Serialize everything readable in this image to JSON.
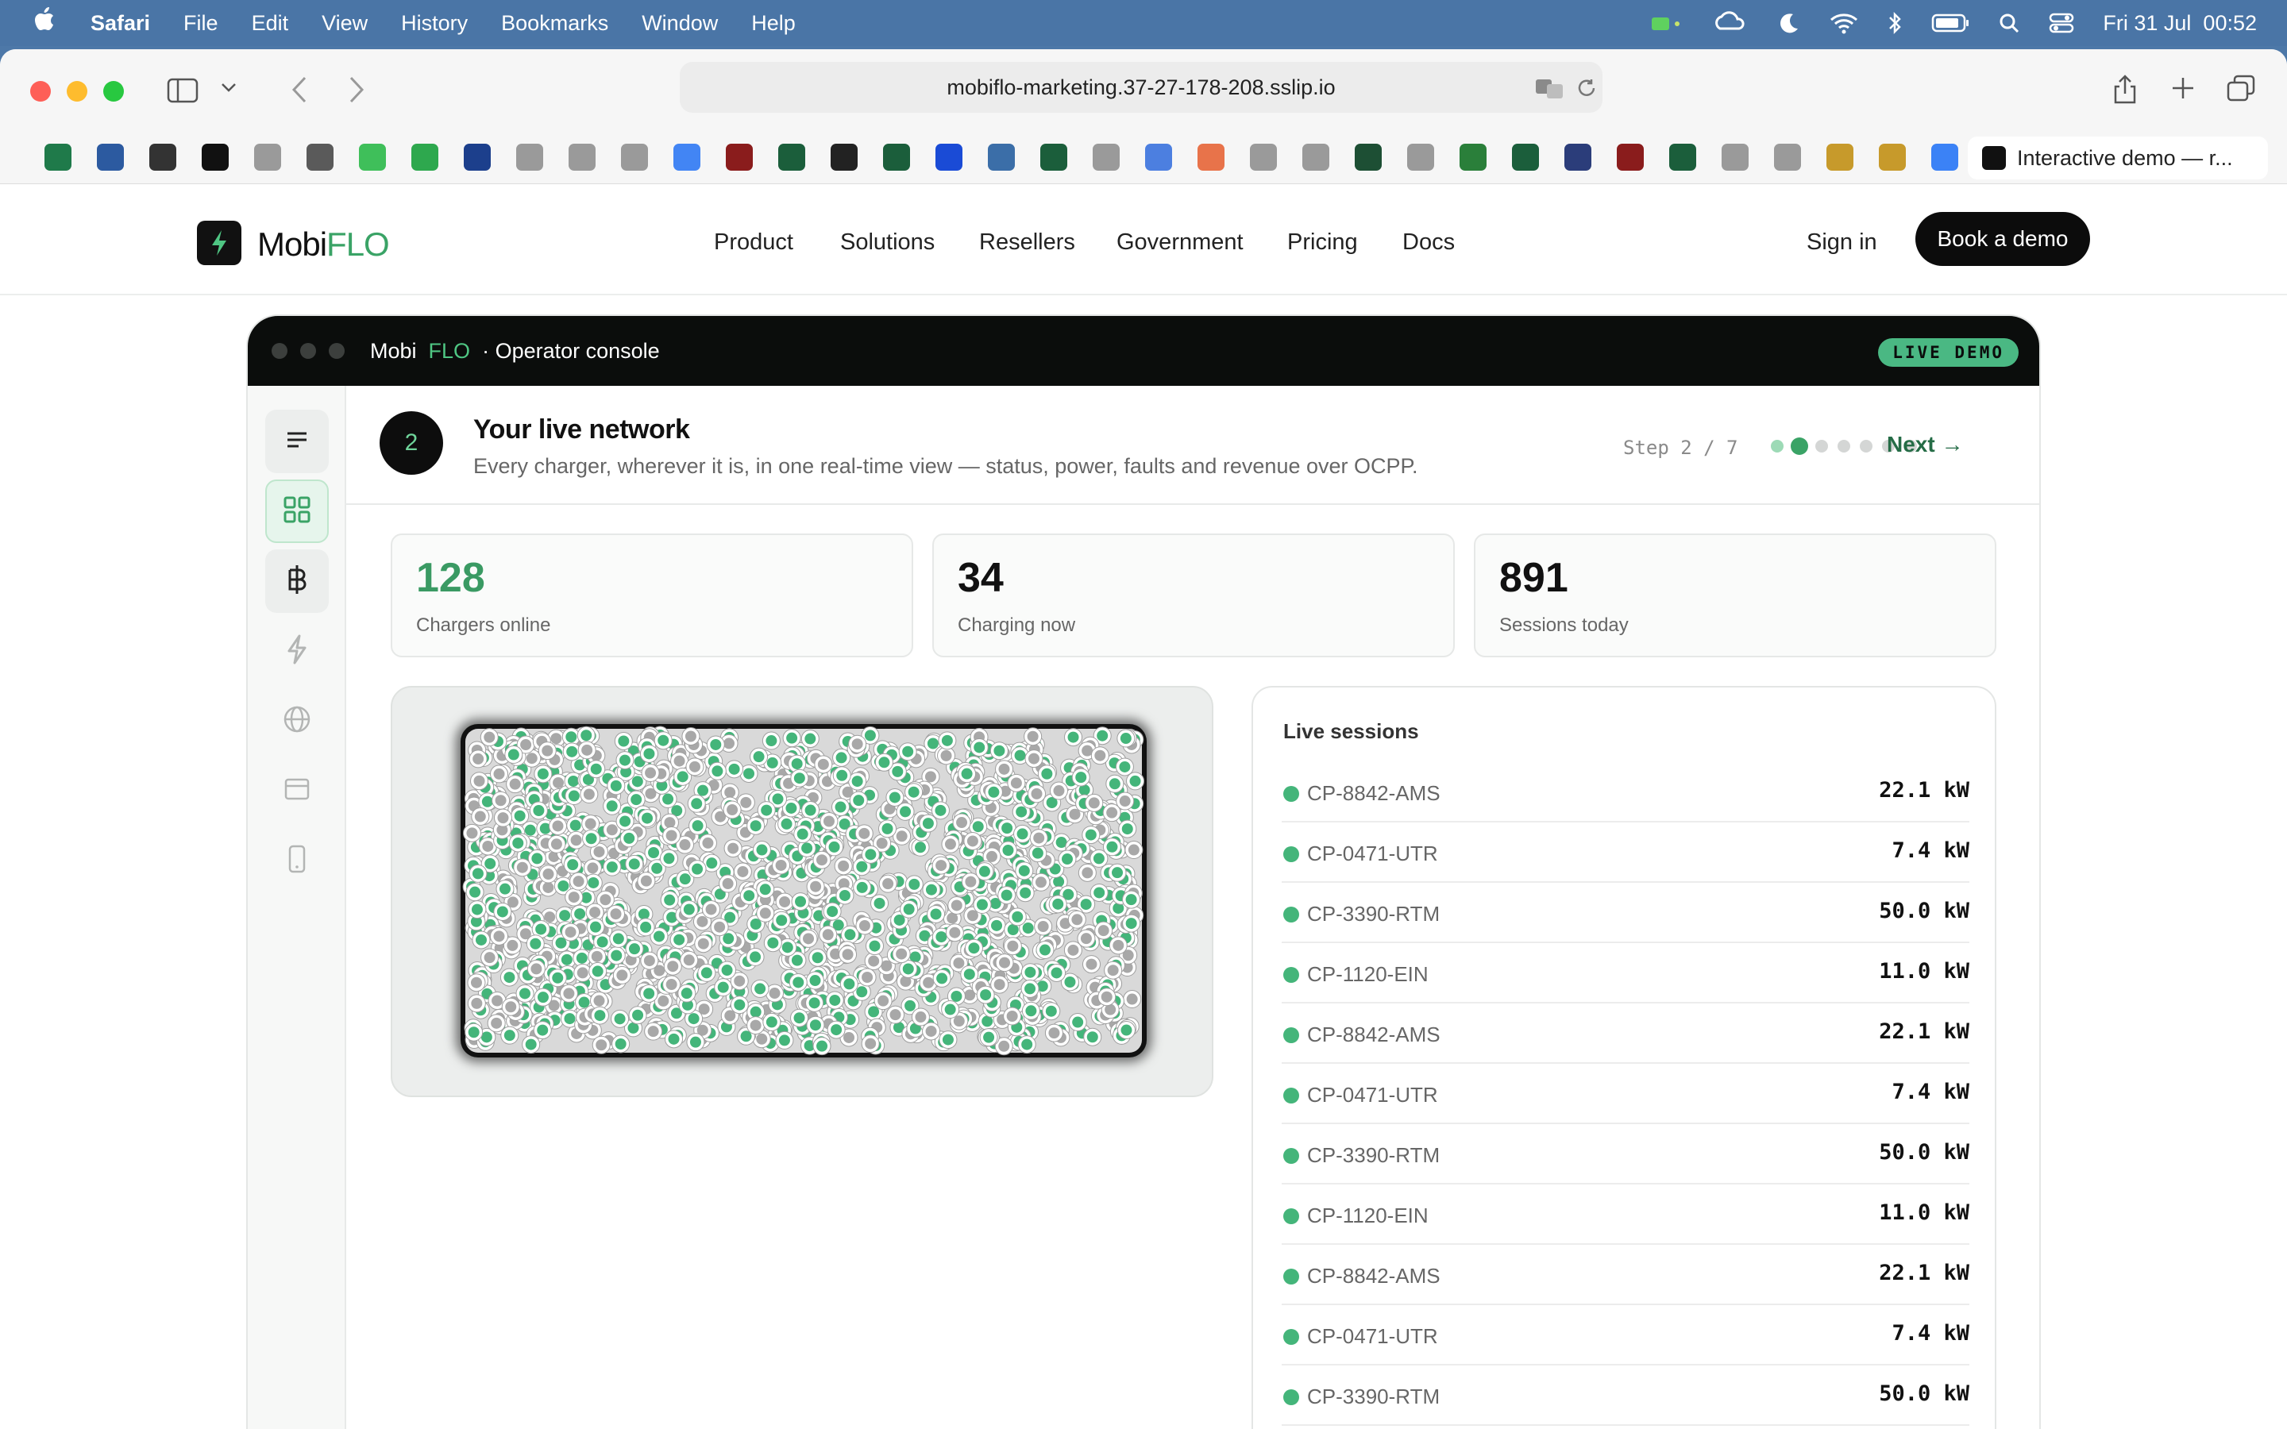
{
  "menubar": {
    "app": "Safari",
    "items": [
      "File",
      "Edit",
      "View",
      "History",
      "Bookmarks",
      "Window",
      "Help"
    ],
    "clock": "Fri 31 Jul  00:52",
    "status_icons": [
      "battery-status-icon",
      "wifi-icon",
      "bluetooth-icon",
      "moon-icon",
      "search-icon",
      "control-center-icon"
    ]
  },
  "browser": {
    "url": "mobiflo-marketing.37-27-178-208.sslip.io",
    "tab_title": "Interactive demo — r...",
    "bookmark_count": 37
  },
  "site": {
    "logo_mobi": "Mobi",
    "logo_flo": "FLO",
    "nav": [
      "Product",
      "Solutions",
      "Resellers",
      "Government",
      "Pricing",
      "Docs"
    ],
    "sign_in": "Sign in",
    "book_demo": "Book a demo"
  },
  "console": {
    "title_mobi": "Mobi",
    "title_flo": "FLO",
    "title_rest": "· Operator console",
    "badge": "LIVE DEMO",
    "rail": [
      "menu-icon",
      "grid-icon",
      "baht-icon",
      "bolt-icon",
      "globe-icon",
      "billing-icon",
      "mobile-icon"
    ]
  },
  "step": {
    "number": "2",
    "title": "Your live network",
    "subtitle": "Every charger, wherever it is, in one real-time view — status, power, faults and revenue over OCPP.",
    "counter": "Step 2 / 7",
    "current": 2,
    "total": 7,
    "next": "Next →"
  },
  "stats": [
    {
      "value": "128",
      "label": "Chargers online"
    },
    {
      "value": "34",
      "label": "Charging now"
    },
    {
      "value": "891",
      "label": "Sessions today"
    }
  ],
  "colors": {
    "accent": "#3aa366",
    "online": "#44b57a",
    "offline": "#a8a8a8",
    "dark": "#0b0d0c"
  },
  "sessions": {
    "title": "Live sessions",
    "rows": [
      {
        "id": "CP-8842-AMS",
        "kw": "22.1 kW"
      },
      {
        "id": "CP-0471-UTR",
        "kw": "7.4 kW"
      },
      {
        "id": "CP-3390-RTM",
        "kw": "50.0 kW"
      },
      {
        "id": "CP-1120-EIN",
        "kw": "11.0 kW"
      },
      {
        "id": "CP-8842-AMS",
        "kw": "22.1 kW"
      },
      {
        "id": "CP-0471-UTR",
        "kw": "7.4 kW"
      },
      {
        "id": "CP-3390-RTM",
        "kw": "50.0 kW"
      },
      {
        "id": "CP-1120-EIN",
        "kw": "11.0 kW"
      },
      {
        "id": "CP-8842-AMS",
        "kw": "22.1 kW"
      },
      {
        "id": "CP-0471-UTR",
        "kw": "7.4 kW"
      },
      {
        "id": "CP-3390-RTM",
        "kw": "50.0 kW"
      }
    ]
  }
}
